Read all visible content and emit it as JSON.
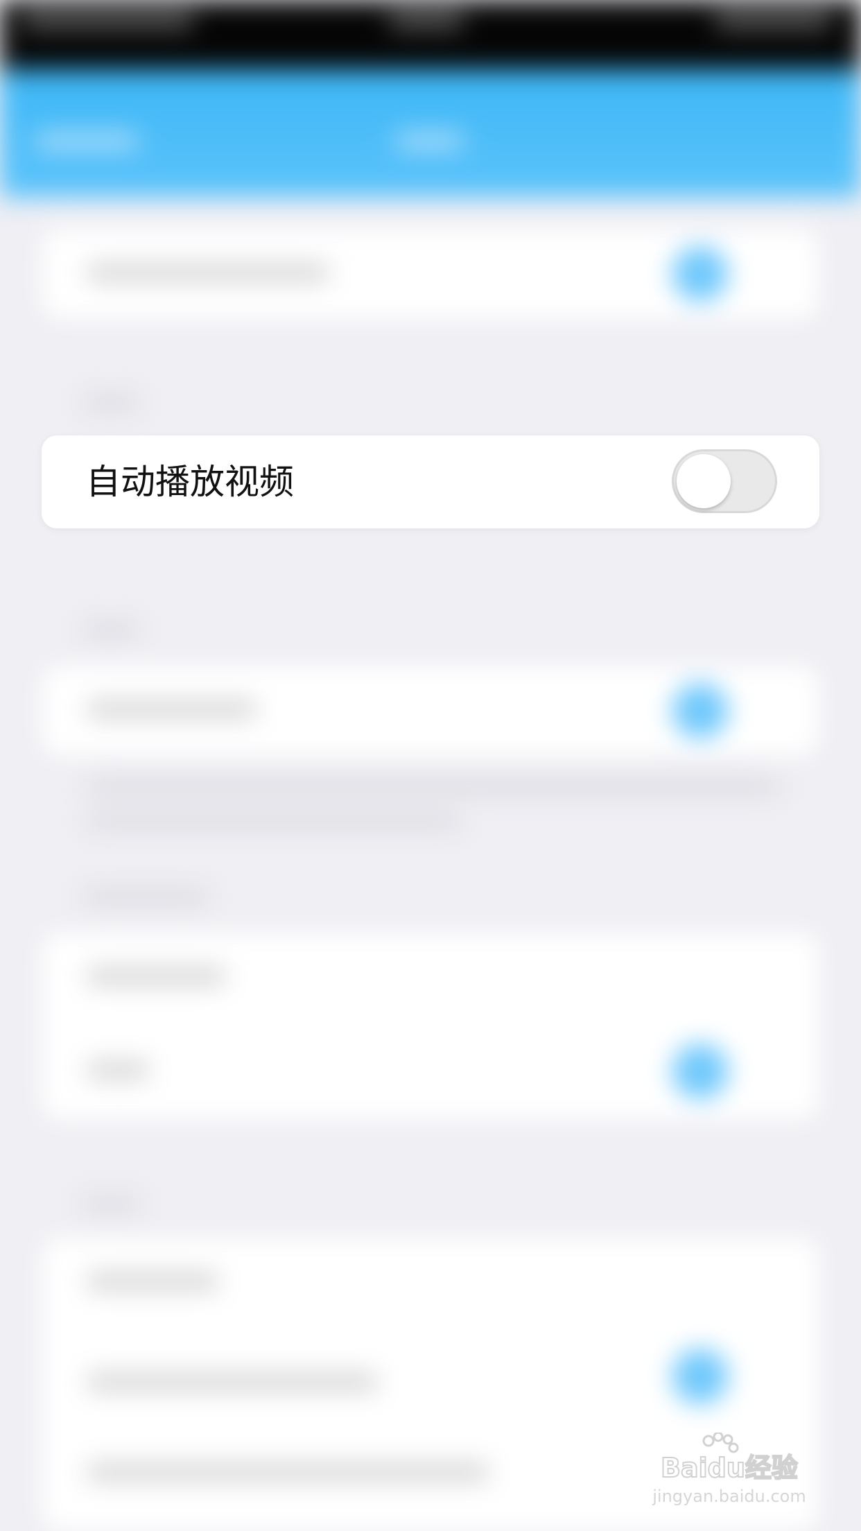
{
  "autoplay_row": {
    "label": "自动播放视频",
    "toggle_on": false
  },
  "colors": {
    "nav_bar": "#3db7f6",
    "background": "#efeff4",
    "toggle_off_track": "#e9e9ea"
  },
  "watermark": {
    "brand": "Baidu经验",
    "url": "jingyan.baidu.com"
  }
}
